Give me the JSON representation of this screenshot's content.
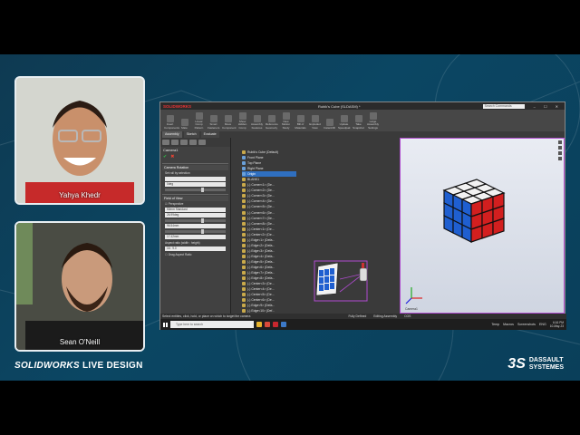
{
  "participants": {
    "top": "Yahya Khedr",
    "bottom": "Sean O'Neill"
  },
  "branding": {
    "show": "SOLIDWORKS LIVE DESIGN",
    "show_brand": "SOLIDWORKS",
    "show_suffix": "LIVE DESIGN",
    "company_line1": "DASSAULT",
    "company_line2": "SYSTEMES"
  },
  "app": {
    "logo": "SOLIDWORKS",
    "title": "Rubik's Cube (SLDASM) *",
    "search_placeholder": "Search Commands",
    "window_buttons": "– ☐ ✕",
    "ribbon": [
      "Insert Components",
      "Mate",
      "Linear Comp Pattern",
      "Smart Fasteners",
      "Move Component",
      "Show Hidden Comp",
      "Assembly Features",
      "Reference Geometry",
      "New Motion Study",
      "Bill of Materials",
      "Exploded View",
      "Instant3D",
      "Update Speedpak",
      "Take Snapshot",
      "Large Assembly Settings"
    ],
    "tabs": [
      "Assembly",
      "Sketch",
      "Evaluate"
    ],
    "panel": {
      "title": "Camera1",
      "camera_rotation_header": "Camera Rotation",
      "camera_rotation_text": "Set roll by selection",
      "camera_rotation_value": "0deg",
      "field_of_view_header": "Field of View",
      "perspective_label": "Perspective",
      "lens_value": "50mm Standard",
      "angle_value": "26.99deg",
      "distance_value": "96.54mm",
      "height_value": "17.42mm",
      "aspect_label": "Aspect ratio (width : height)",
      "aspect_value": "16 : 9.0",
      "drag_label": "Drag Aspect Ratio"
    },
    "tree": [
      "Rubik's Cube (Default)",
      "Front Plane",
      "Top Plane",
      "Right Plane",
      "Origin",
      "BLANK1",
      "(-) Corner<1> (De...",
      "(-) Corner<2> (De...",
      "(-) Corner<3> (De...",
      "(-) Corner<4> (De...",
      "(-) Corner<5> (De...",
      "(-) Corner<6> (De...",
      "(-) Corner<7> (De...",
      "(-) Corner<8> (De...",
      "(-) Center<1> (De...",
      "(-) Center<2> (De...",
      "(-) Edge<1> (Defa...",
      "(-) Edge<2> (Defa...",
      "(-) Edge<3> (Defa...",
      "(-) Edge<4> (Defa...",
      "(-) Edge<5> (Defa...",
      "(-) Edge<6> (Defa...",
      "(-) Edge<7> (Defa...",
      "(-) Edge<8> (Defa...",
      "(-) Center<3> (De...",
      "(-) Center<4> (De...",
      "(-) Center<5> (De...",
      "(-) Center<6> (De...",
      "(-) Edge<9> (Defa...",
      "(-) Edge<10> (Def...",
      "(-) Edge<11> (Def..."
    ],
    "viewport_label": "Camera1",
    "status": {
      "hint": "Select entities, click, hold, or place on which to target the camera",
      "defined": "Fully Defined",
      "mode": "Editing Assembly",
      "units": "CGS",
      "model_tabs": [
        "Model",
        "Motion Study 1",
        "Motion Study 2"
      ]
    },
    "taskbar": {
      "search": "Type here to search",
      "weather": "Temp",
      "app1": "Macros",
      "app2": "Screenshots",
      "lang": "ENG",
      "time": "6:16 PM",
      "date": "10-May-23"
    }
  },
  "colors": {
    "cube_white": "#f2f2f2",
    "cube_blue": "#1f5fd0",
    "cube_red": "#d21f1f",
    "selection": "#b04bd0"
  }
}
